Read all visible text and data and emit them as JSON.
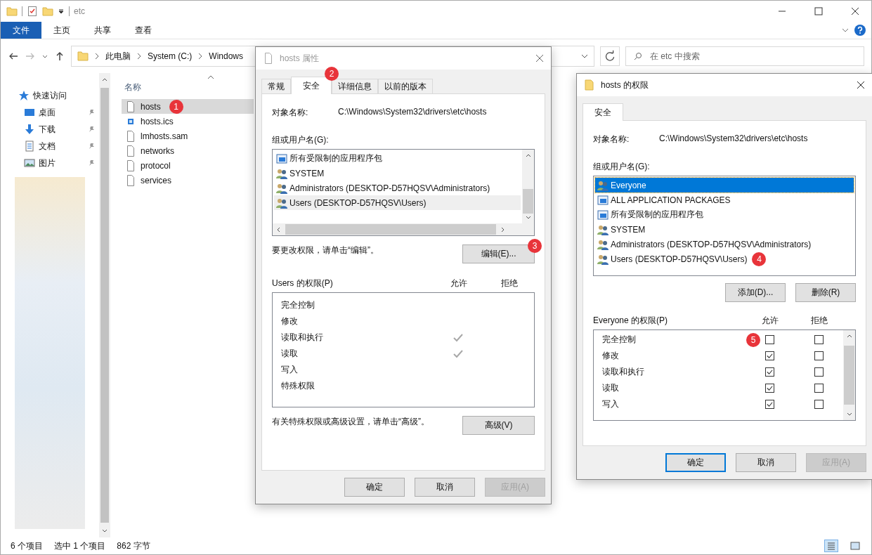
{
  "explorer": {
    "title": "etc",
    "ribbon_tabs": [
      {
        "label": "文件",
        "selected": true
      },
      {
        "label": "主页",
        "selected": false
      },
      {
        "label": "共享",
        "selected": false
      },
      {
        "label": "查看",
        "selected": false
      }
    ],
    "breadcrumb": [
      "此电脑",
      "System (C:)",
      "Windows"
    ],
    "search": {
      "placeholder": "在 etc 中搜索"
    },
    "nav": [
      {
        "label": "快速访问",
        "kind": "star",
        "pinned": false
      },
      {
        "label": "桌面",
        "kind": "desktop",
        "pinned": true
      },
      {
        "label": "下载",
        "kind": "download",
        "pinned": true
      },
      {
        "label": "文档",
        "kind": "document",
        "pinned": true
      },
      {
        "label": "图片",
        "kind": "picture",
        "pinned": true
      }
    ],
    "column_header": "名称",
    "files": [
      {
        "name": "hosts",
        "kind": "file",
        "selected": true,
        "badge": "1"
      },
      {
        "name": "hosts.ics",
        "kind": "ics",
        "selected": false
      },
      {
        "name": "lmhosts.sam",
        "kind": "file",
        "selected": false
      },
      {
        "name": "networks",
        "kind": "file",
        "selected": false
      },
      {
        "name": "protocol",
        "kind": "file",
        "selected": false
      },
      {
        "name": "services",
        "kind": "file",
        "selected": false
      }
    ],
    "status_bar": {
      "count": "6 个项目",
      "selection": "选中 1 个项目",
      "size": "862 字节"
    }
  },
  "properties_dialog": {
    "title": "hosts 属性",
    "tabs": [
      {
        "label": "常规",
        "selected": false
      },
      {
        "label": "安全",
        "selected": true,
        "badge": "2"
      },
      {
        "label": "详细信息",
        "selected": false
      },
      {
        "label": "以前的版本",
        "selected": false
      }
    ],
    "object_label": "对象名称:",
    "object_path": "C:\\Windows\\System32\\drivers\\etc\\hosts",
    "groups_label": "组或用户名(G):",
    "groups": [
      {
        "name": "所有受限制的应用程序包",
        "kind": "package",
        "selected": false
      },
      {
        "name": "SYSTEM",
        "kind": "group",
        "selected": false
      },
      {
        "name": "Administrators (DESKTOP-D57HQSV\\Administrators)",
        "kind": "group",
        "selected": false
      },
      {
        "name": "Users (DESKTOP-D57HQSV\\Users)",
        "kind": "group",
        "selected": true
      }
    ],
    "edit_hint": "要更改权限，请单击“编辑”。",
    "edit_button": "编辑(E)...",
    "edit_badge": "3",
    "permissions_label": "Users 的权限(P)",
    "allow_header": "允许",
    "deny_header": "拒绝",
    "permissions": [
      {
        "name": "完全控制",
        "allow": false,
        "deny": false
      },
      {
        "name": "修改",
        "allow": false,
        "deny": false
      },
      {
        "name": "读取和执行",
        "allow": true,
        "deny": false
      },
      {
        "name": "读取",
        "allow": true,
        "deny": false
      },
      {
        "name": "写入",
        "allow": false,
        "deny": false
      },
      {
        "name": "特殊权限",
        "allow": false,
        "deny": false
      }
    ],
    "advanced_hint": "有关特殊权限或高级设置，请单击“高级”。",
    "advanced_button": "高级(V)",
    "buttons": [
      {
        "label": "确定",
        "disabled": false
      },
      {
        "label": "取消",
        "disabled": false
      },
      {
        "label": "应用(A)",
        "disabled": true
      }
    ]
  },
  "permissions_dialog": {
    "title": "hosts 的权限",
    "tabs": [
      {
        "label": "安全",
        "selected": true
      }
    ],
    "object_label": "对象名称:",
    "object_path": "C:\\Windows\\System32\\drivers\\etc\\hosts",
    "groups_label": "组或用户名(G):",
    "groups": [
      {
        "name": "Everyone",
        "kind": "group",
        "selected": true
      },
      {
        "name": "ALL APPLICATION PACKAGES",
        "kind": "package",
        "selected": false
      },
      {
        "name": "所有受限制的应用程序包",
        "kind": "package",
        "selected": false
      },
      {
        "name": "SYSTEM",
        "kind": "group",
        "selected": false
      },
      {
        "name": "Administrators (DESKTOP-D57HQSV\\Administrators)",
        "kind": "group",
        "selected": false
      },
      {
        "name": "Users (DESKTOP-D57HQSV\\Users)",
        "kind": "group",
        "selected": false,
        "badge": "4"
      }
    ],
    "group_buttons": [
      "添加(D)...",
      "删除(R)"
    ],
    "permissions_label": "Everyone 的权限(P)",
    "allow_header": "允许",
    "deny_header": "拒绝",
    "permissions": [
      {
        "name": "完全控制",
        "allow": false,
        "deny": false,
        "badge": "5"
      },
      {
        "name": "修改",
        "allow": true,
        "deny": false
      },
      {
        "name": "读取和执行",
        "allow": true,
        "deny": false
      },
      {
        "name": "读取",
        "allow": true,
        "deny": false
      },
      {
        "name": "写入",
        "allow": true,
        "deny": false
      }
    ],
    "buttons": [
      {
        "label": "确定",
        "disabled": false,
        "default": true
      },
      {
        "label": "取消",
        "disabled": false,
        "default": false
      },
      {
        "label": "应用(A)",
        "disabled": true,
        "default": false
      }
    ]
  }
}
